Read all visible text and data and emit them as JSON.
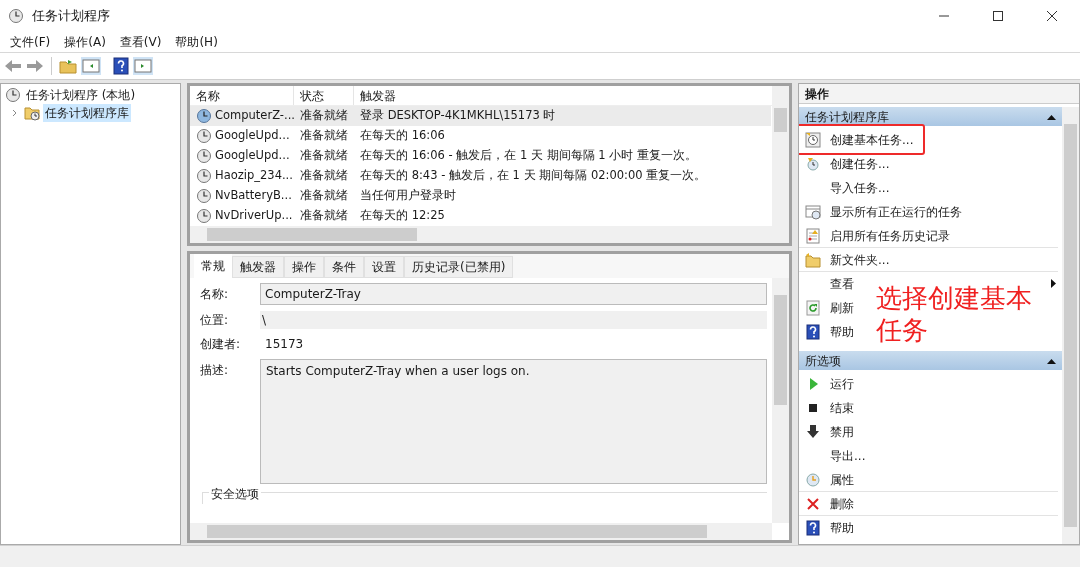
{
  "window": {
    "title": "任务计划程序"
  },
  "menu": [
    {
      "label": "文件(F)"
    },
    {
      "label": "操作(A)"
    },
    {
      "label": "查看(V)"
    },
    {
      "label": "帮助(H)"
    }
  ],
  "tree": [
    {
      "label": "任务计划程序 (本地)",
      "selected": false,
      "children": [
        {
          "label": "任务计划程序库",
          "selected": true,
          "expanded": false
        }
      ]
    }
  ],
  "task_list": {
    "columns": [
      "名称",
      "状态",
      "触发器"
    ],
    "rows": [
      {
        "name": "ComputerZ-...",
        "status": "准备就绪",
        "trigger": "登录 DESKTOP-4K1MKHL\\15173 时",
        "selected": true
      },
      {
        "name": "GoogleUpd...",
        "status": "准备就绪",
        "trigger": "在每天的 16:06",
        "selected": false
      },
      {
        "name": "GoogleUpd...",
        "status": "准备就绪",
        "trigger": "在每天的 16:06 - 触发后，在 1 天 期间每隔 1 小时 重复一次。",
        "selected": false
      },
      {
        "name": "Haozip_234...",
        "status": "准备就绪",
        "trigger": "在每天的 8:43 - 触发后，在 1 天 期间每隔 02:00:00 重复一次。",
        "selected": false
      },
      {
        "name": "NvBatteryB...",
        "status": "准备就绪",
        "trigger": "当任何用户登录时",
        "selected": false
      },
      {
        "name": "NvDriverUp...",
        "status": "准备就绪",
        "trigger": "在每天的 12:25",
        "selected": false
      }
    ]
  },
  "detail": {
    "tabs": [
      {
        "label": "常规",
        "selected": true
      },
      {
        "label": "触发器",
        "selected": false
      },
      {
        "label": "操作",
        "selected": false
      },
      {
        "label": "条件",
        "selected": false
      },
      {
        "label": "设置",
        "selected": false
      },
      {
        "label": "历史记录(已禁用)",
        "selected": false
      }
    ],
    "fields": [
      {
        "label": "名称:",
        "value": "ComputerZ-Tray",
        "kind": "box"
      },
      {
        "label": "位置:",
        "value": "\\",
        "kind": "flat"
      },
      {
        "label": "创建者:",
        "value": "15173",
        "kind": "plain"
      },
      {
        "label": "描述:",
        "value": "Starts ComputerZ-Tray when a user logs on.",
        "kind": "area"
      }
    ],
    "section": "安全选项"
  },
  "actions": {
    "title": "操作",
    "groups": [
      {
        "title": "任务计划程序库",
        "items": [
          {
            "label": "创建基本任务...",
            "kind": "basic-task",
            "highlighted": true,
            "divider": false
          },
          {
            "label": "创建任务...",
            "kind": "task",
            "highlighted": false,
            "divider": false
          },
          {
            "label": "导入任务...",
            "kind": "none",
            "highlighted": false,
            "divider": false
          },
          {
            "label": "显示所有正在运行的任务",
            "kind": "running",
            "highlighted": false,
            "divider": false
          },
          {
            "label": "启用所有任务历史记录",
            "kind": "history",
            "highlighted": false,
            "divider": true
          },
          {
            "label": "新文件夹...",
            "kind": "folder",
            "highlighted": false,
            "divider": true
          },
          {
            "label": "查看",
            "kind": "submenu",
            "highlighted": false,
            "divider": false
          },
          {
            "label": "刷新",
            "kind": "refresh",
            "highlighted": false,
            "divider": false
          },
          {
            "label": "帮助",
            "kind": "help",
            "highlighted": false,
            "divider": false
          }
        ]
      },
      {
        "title": "所选项",
        "items": [
          {
            "label": "运行",
            "kind": "run",
            "highlighted": false,
            "divider": false
          },
          {
            "label": "结束",
            "kind": "stop",
            "highlighted": false,
            "divider": false
          },
          {
            "label": "禁用",
            "kind": "disable",
            "highlighted": false,
            "divider": false
          },
          {
            "label": "导出...",
            "kind": "none",
            "highlighted": false,
            "divider": false
          },
          {
            "label": "属性",
            "kind": "properties",
            "highlighted": false,
            "divider": true
          },
          {
            "label": "删除",
            "kind": "delete",
            "highlighted": false,
            "divider": true
          },
          {
            "label": "帮助",
            "kind": "help",
            "highlighted": false,
            "divider": false
          }
        ]
      }
    ]
  },
  "annotation": {
    "text": "选择创建基本任务"
  }
}
